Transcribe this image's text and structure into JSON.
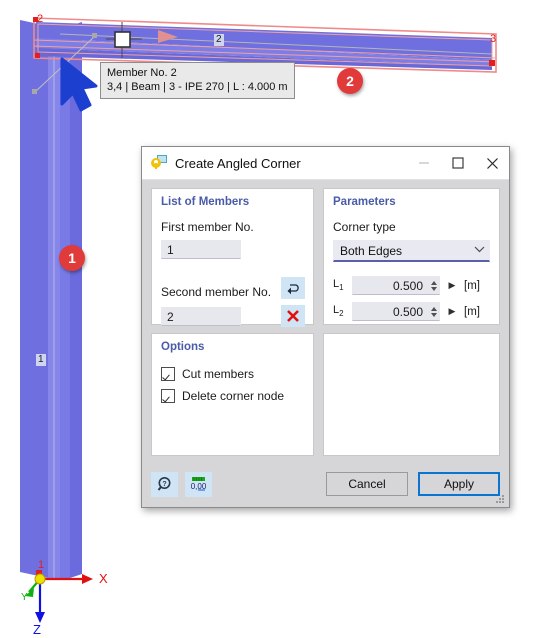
{
  "viewport": {
    "member_labels": [
      {
        "text": "1"
      },
      {
        "text": "2"
      }
    ],
    "node_labels": [
      {
        "text": "2"
      },
      {
        "text": "3"
      },
      {
        "text": "1"
      }
    ],
    "callouts": [
      {
        "text": "1"
      },
      {
        "text": "2"
      }
    ],
    "axes": [
      {
        "name": "x-axis-label",
        "text": "X",
        "color": "#e11010"
      },
      {
        "name": "y-axis-label",
        "text": "Y",
        "color": "#10b010"
      },
      {
        "name": "z-axis-label",
        "text": "Z",
        "color": "#1010e0"
      }
    ],
    "tooltip": {
      "line1": "Member No. 2",
      "line2": "3,4 | Beam | 3 - IPE 270 | L : 4.000 m"
    },
    "colors": {
      "member_fill": "#6f6fe0",
      "selection": "#f08a8a",
      "node_marker": "#e02020",
      "cursor": "#1c3fd0"
    }
  },
  "dialog": {
    "title": "Create Angled Corner",
    "window_controls": {
      "minimize": "—",
      "maximize": "☐",
      "close": "✕"
    },
    "list_of_members": {
      "title": "List of Members",
      "first_member_label": "First member No.",
      "first_member_value": "1",
      "second_member_label": "Second member No.",
      "second_member_value": "2",
      "swap_icon": "swap-arrow-icon",
      "delete_icon": "red-x-icon"
    },
    "parameters": {
      "title": "Parameters",
      "corner_type_label": "Corner type",
      "corner_type_value": "Both Edges",
      "corner_type_options": [
        "Both Edges"
      ],
      "rows": [
        {
          "label": "L",
          "sub": "1",
          "value": "0.500",
          "unit": "[m]"
        },
        {
          "label": "L",
          "sub": "2",
          "value": "0.500",
          "unit": "[m]"
        }
      ]
    },
    "options": {
      "title": "Options",
      "items": [
        {
          "label": "Cut members",
          "checked": true
        },
        {
          "label": "Delete corner node",
          "checked": true
        }
      ]
    },
    "footer": {
      "help_icon": "help-magnifier-icon",
      "units_icon": "decimal-places-icon",
      "units_icon_text": "0,00",
      "cancel_label": "Cancel",
      "apply_label": "Apply"
    },
    "accent_color": "#0a75d0",
    "section_title_color": "#4a5ba8"
  }
}
